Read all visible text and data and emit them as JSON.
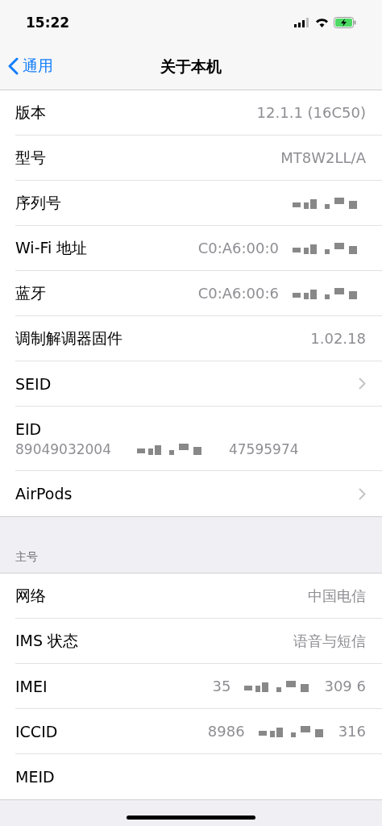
{
  "status_bar": {
    "time": "15:22",
    "charging": true
  },
  "nav": {
    "back": "通用",
    "title": "关于本机"
  },
  "groups": [
    {
      "rows": [
        {
          "kind": "value",
          "label": "版本",
          "value": "12.1.1 (16C50)"
        },
        {
          "kind": "value",
          "label": "型号",
          "value": "MT8W2LL/A"
        },
        {
          "kind": "value",
          "label": "序列号",
          "redacted": true
        },
        {
          "kind": "value",
          "label": "Wi-Fi 地址",
          "value": "C0:A6:00:0",
          "redacted": true
        },
        {
          "kind": "value",
          "label": "蓝牙",
          "value": "C0:A6:00:6",
          "redacted": true
        },
        {
          "kind": "value",
          "label": "调制解调器固件",
          "value": "1.02.18"
        },
        {
          "kind": "link",
          "label": "SEID"
        },
        {
          "kind": "stacked",
          "label": "EID",
          "value": "89049032004",
          "value_end": "47595974",
          "redacted": true
        },
        {
          "kind": "link",
          "label": "AirPods"
        }
      ]
    },
    {
      "header": "主号",
      "rows": [
        {
          "kind": "value",
          "label": "网络",
          "value": "中国电信"
        },
        {
          "kind": "value",
          "label": "IMS 状态",
          "value": "语音与短信"
        },
        {
          "kind": "value",
          "label": "IMEI",
          "value": "35",
          "value_end": "309 6",
          "redacted": true
        },
        {
          "kind": "value",
          "label": "ICCID",
          "value": "8986",
          "value_end": "316",
          "redacted": true
        },
        {
          "kind": "value",
          "label": "MEID"
        }
      ]
    }
  ]
}
